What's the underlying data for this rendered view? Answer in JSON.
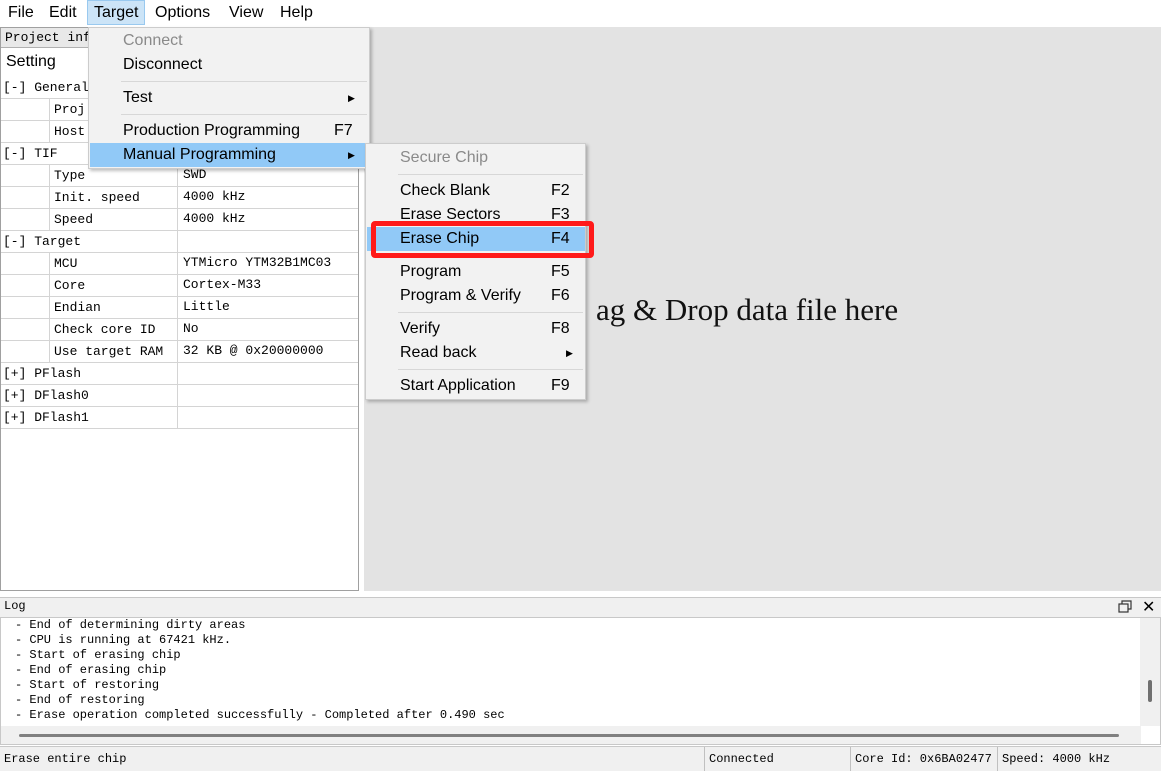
{
  "menubar": {
    "items": [
      "File",
      "Edit",
      "Target",
      "Options",
      "View",
      "Help"
    ]
  },
  "left_panel": {
    "tab": "Project info",
    "header": "Setting",
    "rows": [
      {
        "k": "[-] General",
        "v": ""
      },
      {
        "k": "Proj",
        "v": ""
      },
      {
        "k": "Host",
        "v": ""
      },
      {
        "k": "[-] TIF",
        "v": ""
      },
      {
        "k": "Type",
        "v": "SWD"
      },
      {
        "k": "Init. speed",
        "v": "4000 kHz"
      },
      {
        "k": "Speed",
        "v": "4000 kHz"
      },
      {
        "k": "[-] Target",
        "v": ""
      },
      {
        "k": "MCU",
        "v": "YTMicro YTM32B1MC03"
      },
      {
        "k": "Core",
        "v": "Cortex-M33"
      },
      {
        "k": "Endian",
        "v": "Little"
      },
      {
        "k": "Check core ID",
        "v": "No"
      },
      {
        "k": "Use target RAM",
        "v": "32 KB @ 0x20000000"
      },
      {
        "k": "[+] PFlash",
        "v": ""
      },
      {
        "k": "[+] DFlash0",
        "v": ""
      },
      {
        "k": "[+] DFlash1",
        "v": ""
      }
    ]
  },
  "drop_area": {
    "text": "Drag & Drop data file here",
    "visible_text": "ag & Drop data file here"
  },
  "target_menu": {
    "items": [
      {
        "label": "Connect",
        "shortcut": "",
        "disabled": true
      },
      {
        "label": "Disconnect",
        "shortcut": ""
      },
      {
        "label": "Test",
        "shortcut": "",
        "submenu": true
      },
      {
        "label": "Production Programming",
        "shortcut": "F7"
      },
      {
        "label": "Manual Programming",
        "shortcut": "",
        "submenu": true,
        "highlighted": true
      }
    ],
    "arrow": "▶"
  },
  "manual_menu": {
    "items": [
      {
        "label": "Secure Chip",
        "shortcut": "",
        "disabled": true
      },
      {
        "label": "Check Blank",
        "shortcut": "F2"
      },
      {
        "label": "Erase Sectors",
        "shortcut": "F3"
      },
      {
        "label": "Erase Chip",
        "shortcut": "F4",
        "highlighted": true
      },
      {
        "label": "Program",
        "shortcut": "F5"
      },
      {
        "label": "Program & Verify",
        "shortcut": "F6"
      },
      {
        "label": "Verify",
        "shortcut": "F8"
      },
      {
        "label": "Read back",
        "shortcut": "",
        "submenu": true
      },
      {
        "label": "Start Application",
        "shortcut": "F9"
      }
    ]
  },
  "log": {
    "title": "Log",
    "lines": [
      "- End of determining dirty areas",
      "- CPU is running at 67421 kHz.",
      "- Start of erasing chip",
      "- End of erasing chip",
      "- Start of restoring",
      "- End of restoring",
      "- Erase operation completed successfully - Completed after 0.490 sec"
    ],
    "close_glyph": "✕"
  },
  "statusbar": {
    "message": "Erase entire chip",
    "connection": "Connected",
    "core_id": "Core Id: 0x6BA02477",
    "speed": "Speed: 4000 kHz"
  },
  "colors": {
    "menu_highlight": "#91c9f7",
    "annotation_box": "#ff1a1a",
    "drop_area_bg": "#e3e3e3"
  }
}
